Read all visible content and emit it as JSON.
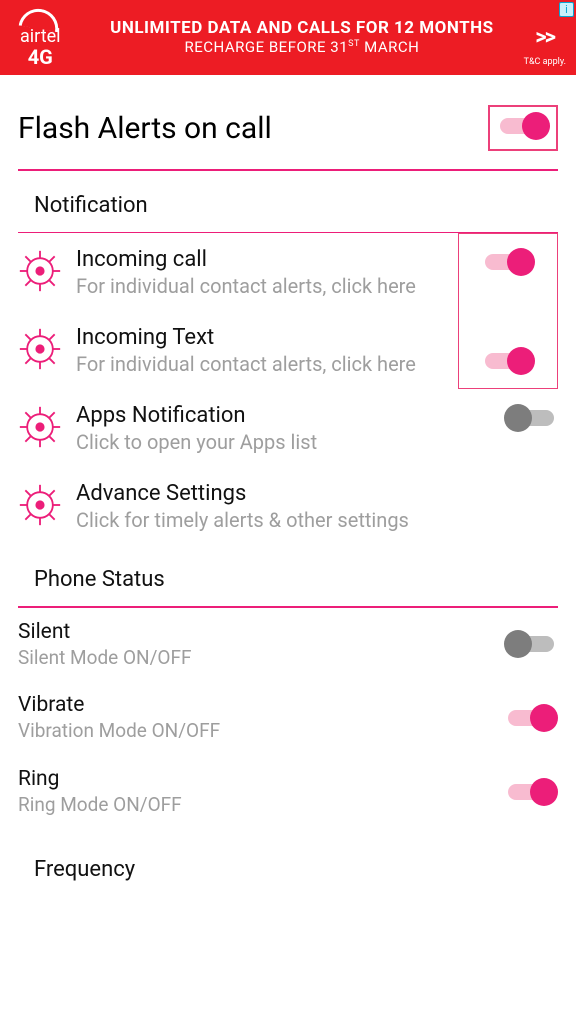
{
  "ad": {
    "brand": "airtel",
    "brand_sub": "4G",
    "line1": "UNLIMITED DATA AND CALLS FOR 12 MONTHS",
    "line2_pre": "RECHARGE BEFORE 31",
    "line2_sup": "ST",
    "line2_post": " MARCH",
    "arrow": ">>",
    "tc": "T&C apply.",
    "info": "i"
  },
  "header": {
    "title": "Flash Alerts on call",
    "toggle": true
  },
  "sections": {
    "notification": {
      "title": "Notification",
      "items": [
        {
          "title": "Incoming call",
          "sub": "For individual contact alerts, click here",
          "toggle": true
        },
        {
          "title": "Incoming Text",
          "sub": "For individual contact alerts, click here",
          "toggle": true
        },
        {
          "title": "Apps Notification",
          "sub": "Click to open your Apps list",
          "toggle": false
        },
        {
          "title": "Advance Settings",
          "sub": "Click for timely alerts & other settings",
          "toggle": null
        }
      ]
    },
    "phone_status": {
      "title": "Phone Status",
      "items": [
        {
          "title": "Silent",
          "sub": "Silent Mode ON/OFF",
          "toggle": false
        },
        {
          "title": "Vibrate",
          "sub": "Vibration Mode ON/OFF",
          "toggle": true
        },
        {
          "title": "Ring",
          "sub": "Ring Mode ON/OFF",
          "toggle": true
        }
      ]
    },
    "frequency": {
      "title": "Frequency"
    }
  },
  "colors": {
    "accent": "#ec1e79"
  }
}
